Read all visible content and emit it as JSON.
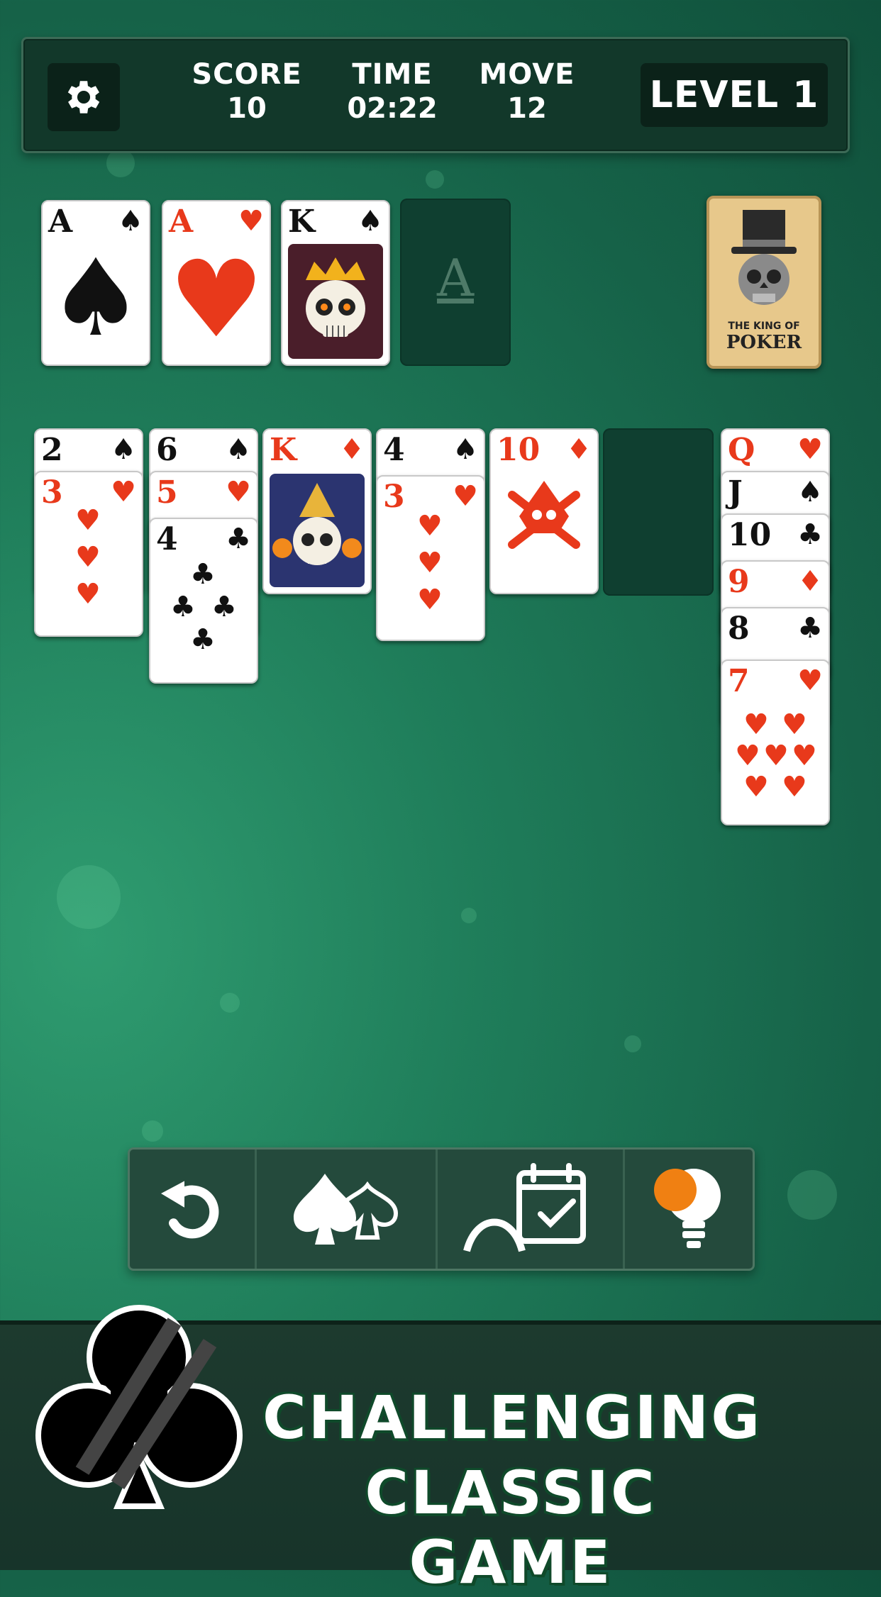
{
  "hud": {
    "score_label": "SCORE",
    "score_value": "10",
    "time_label": "TIME",
    "time_value": "02:22",
    "move_label": "MOVE",
    "move_value": "12",
    "level_text": "LEVEL 1"
  },
  "foundations": [
    {
      "rank": "A",
      "suit": "♠",
      "color": "black"
    },
    {
      "rank": "A",
      "suit": "♥",
      "color": "red"
    },
    {
      "rank": "K",
      "suit": "♠",
      "color": "black"
    },
    {
      "placeholder": "A"
    }
  ],
  "stock": {
    "line1": "THE KING OF",
    "line2": "POKER"
  },
  "tableau": [
    [
      {
        "rank": "2",
        "suit": "♠"
      },
      {
        "rank": "3",
        "suit": "♥"
      }
    ],
    [
      {
        "rank": "6",
        "suit": "♠"
      },
      {
        "rank": "5",
        "suit": "♥"
      },
      {
        "rank": "4",
        "suit": "♣"
      }
    ],
    [
      {
        "rank": "K",
        "suit": "♦"
      }
    ],
    [
      {
        "rank": "4",
        "suit": "♠"
      },
      {
        "rank": "3",
        "suit": "♥"
      }
    ],
    [
      {
        "rank": "10",
        "suit": "♦"
      }
    ],
    [],
    [
      {
        "rank": "Q",
        "suit": "♥"
      },
      {
        "rank": "J",
        "suit": "♠"
      },
      {
        "rank": "10",
        "suit": "♣"
      },
      {
        "rank": "9",
        "suit": "♦"
      },
      {
        "rank": "8",
        "suit": "♣"
      },
      {
        "rank": "7",
        "suit": "♥"
      }
    ]
  ],
  "toolbar": [
    "undo-icon",
    "spade-ornament-icon",
    "daily-calendar-icon",
    "hint-bulb-icon"
  ],
  "banner": {
    "line1": "CHALLENGING",
    "line2": "CLASSIC GAME"
  },
  "colors": {
    "red": "#e8391b",
    "felt": "#1f7d5a",
    "hud": "#12382a"
  }
}
